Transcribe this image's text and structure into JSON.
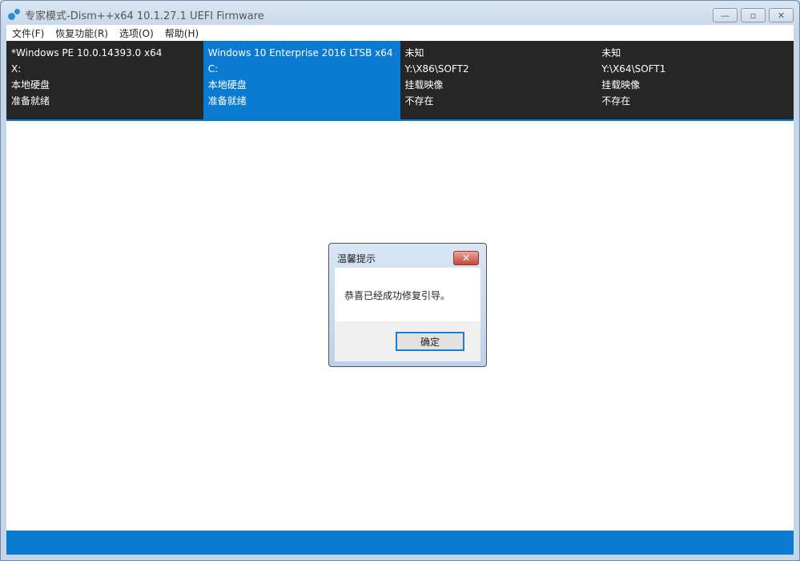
{
  "window": {
    "title": "专家模式-Dism++x64 10.1.27.1 UEFI Firmware",
    "controls": {
      "minimize": "—",
      "maximize": "▫",
      "close": "✕"
    }
  },
  "menu": [
    "文件(F)",
    "恢复功能(R)",
    "选项(O)",
    "帮助(H)"
  ],
  "images": [
    {
      "name": "*Windows PE 10.0.14393.0 x64",
      "path": "X:",
      "type": "本地硬盘",
      "status": "准备就绪",
      "selected": false
    },
    {
      "name": "Windows 10 Enterprise 2016 LTSB x64",
      "path": "C:",
      "type": "本地硬盘",
      "status": "准备就绪",
      "selected": true
    },
    {
      "name": "未知",
      "path": "Y:\\X86\\SOFT2",
      "type": "挂载映像",
      "status": "不存在",
      "selected": false
    },
    {
      "name": "未知",
      "path": "Y:\\X64\\SOFT1",
      "type": "挂载映像",
      "status": "不存在",
      "selected": false
    }
  ],
  "dialog": {
    "title": "温馨提示",
    "message": "恭喜已经成功修复引导。",
    "ok": "确定",
    "close": "✕"
  },
  "colors": {
    "accent": "#0a7bd0",
    "panel": "#262626"
  }
}
